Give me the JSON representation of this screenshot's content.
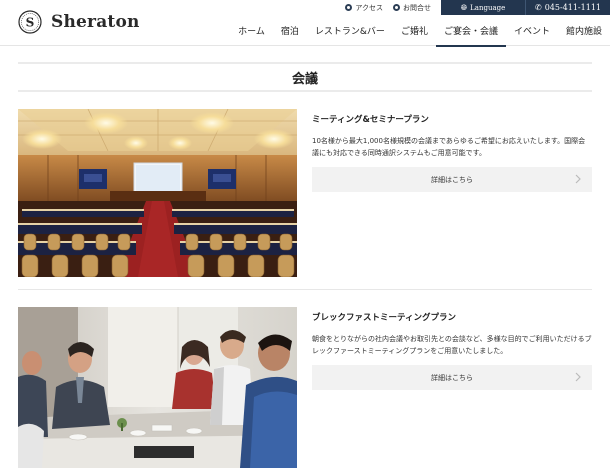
{
  "brand": {
    "name": "Sheraton",
    "emblem_icon": "sheraton-s-emblem"
  },
  "utility": {
    "access": "アクセス",
    "contact": "お問合せ",
    "language": "Language",
    "tel": "045-411-1111"
  },
  "nav": {
    "items": [
      {
        "label": "ホーム"
      },
      {
        "label": "宿泊"
      },
      {
        "label": "レストラン&バー"
      },
      {
        "label": "ご婚礼"
      },
      {
        "label": "ご宴会・会議"
      },
      {
        "label": "イベント"
      },
      {
        "label": "館内施設"
      }
    ],
    "active": "ご宴会・会議"
  },
  "page": {
    "title": "会議"
  },
  "cards": [
    {
      "title": "ミーティング&セミナープラン",
      "desc": "10名様から最大1,000名様規模の会議まであらゆるご希望にお応えいたします。国際会議にも対応できる同時通訳システムもご用意可能です。",
      "button": "詳細はこちら",
      "image": "banquet-hall-seminar-photo"
    },
    {
      "title": "ブレックファストミーティングプラン",
      "desc": "朝食をとりながらの社内会議やお取引先との会談など、多様な目的でご利用いただけるブレックファーストミーティングプランをご用意いたしました。",
      "button": "詳細はこちら",
      "image": "business-breakfast-meeting-photo"
    }
  ],
  "colors": {
    "navy": "#23364f",
    "button_bg": "#f2f2f2",
    "divider": "#ebebeb"
  }
}
